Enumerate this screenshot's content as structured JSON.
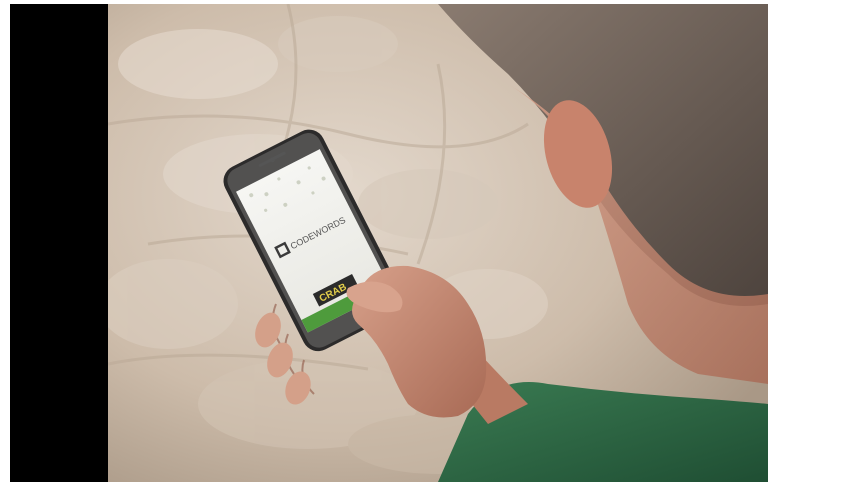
{
  "scene": {
    "description_icons": [
      "smartphone",
      "hand",
      "person"
    ],
    "colors": {
      "ground": "#c9b9a6",
      "stone_light": "#ddd1c4",
      "sweater": "#2f6b45",
      "hair": "#6b5e55",
      "skin": "#c98e76",
      "phone_body": "#2c2b2b",
      "screen": "#f1f1ee",
      "app_bar_green": "#4e9b3c",
      "letterbox": "#000000"
    }
  },
  "phone_screen": {
    "app_name": "CODEWORDS",
    "badge_text": "CRAB"
  }
}
